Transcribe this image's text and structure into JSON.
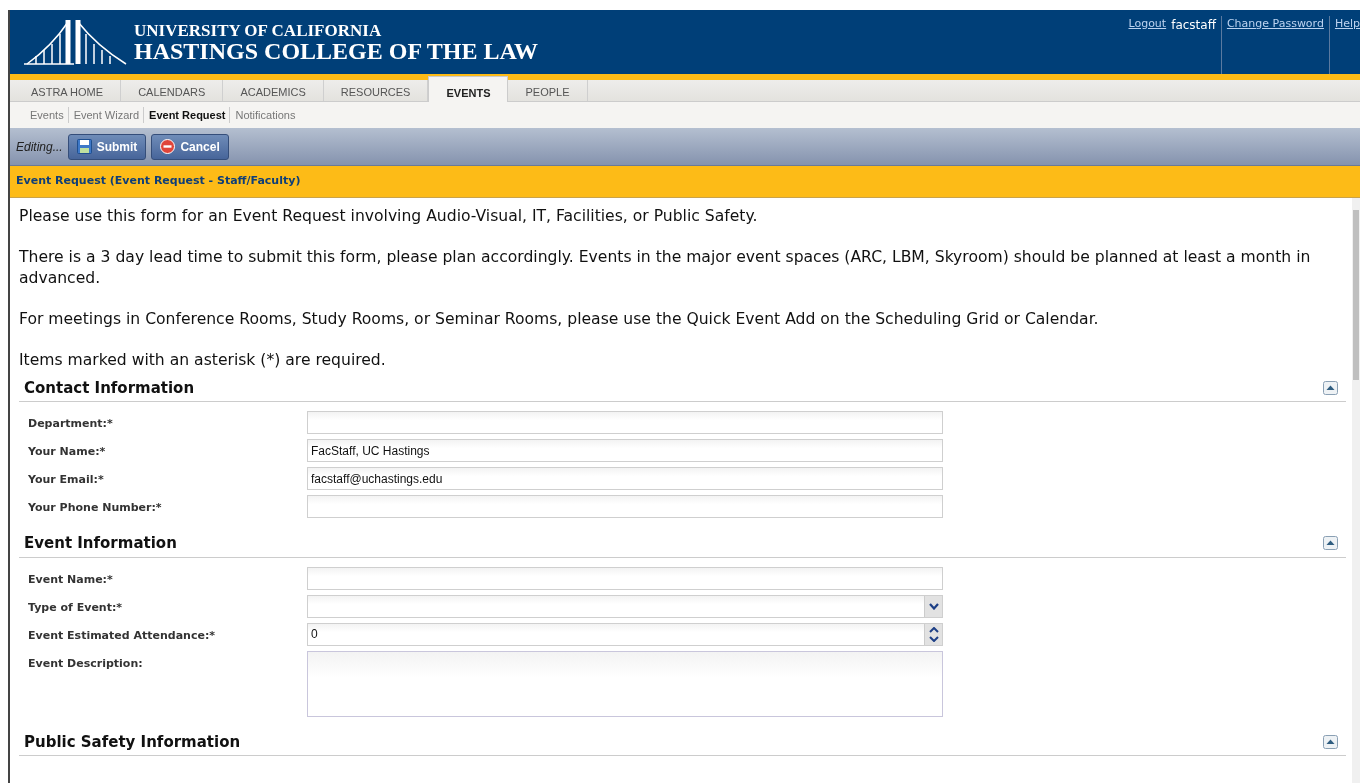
{
  "header": {
    "title_line1": "UNIVERSITY OF CALIFORNIA",
    "title_line2": "HASTINGS COLLEGE OF THE LAW",
    "user_links": [
      {
        "kind": "link",
        "text": "Logout"
      },
      {
        "kind": "user",
        "text": "facstaff"
      },
      {
        "kind": "link",
        "text": "Change Password"
      },
      {
        "kind": "link",
        "text": "Help"
      }
    ]
  },
  "tabs": [
    {
      "label": "ASTRA HOME",
      "selected": false
    },
    {
      "label": "CALENDARS",
      "selected": false
    },
    {
      "label": "ACADEMICS",
      "selected": false
    },
    {
      "label": "RESOURCES",
      "selected": false
    },
    {
      "label": "EVENTS",
      "selected": true
    },
    {
      "label": "PEOPLE",
      "selected": false
    }
  ],
  "subnav": [
    {
      "label": "Events",
      "selected": false
    },
    {
      "label": "Event Wizard",
      "selected": false
    },
    {
      "label": "Event Request",
      "selected": true
    },
    {
      "label": "Notifications",
      "selected": false
    }
  ],
  "toolbar": {
    "status": "Editing...",
    "buttons": [
      {
        "kind": "submit",
        "label": "Submit"
      },
      {
        "kind": "cancel",
        "label": "Cancel"
      }
    ]
  },
  "form_title": "Event Request (Event Request - Staff/Faculty)",
  "intro": [
    "Please use this form for an Event Request involving Audio-Visual, IT, Facilities, or Public Safety.",
    "There is a 3 day lead time to submit this form, please plan accordingly. Events in the major event spaces (ARC, LBM, Skyroom) should be planned at least a month in advanced.",
    "For meetings in Conference Rooms, Study Rooms, or Seminar Rooms, please use the Quick Event Add on the Scheduling Grid or Calendar.",
    "Items marked with an asterisk (*) are required."
  ],
  "sections": [
    {
      "title": "Contact Information",
      "fields": [
        {
          "label": "Department:*",
          "kind": "text"
        },
        {
          "label": "Your Name:*",
          "kind": "text",
          "value": "FacStaff, UC Hastings"
        },
        {
          "label": "Your Email:*",
          "kind": "text",
          "value": "facstaff@uchastings.edu"
        },
        {
          "label": "Your Phone Number:*",
          "kind": "text"
        }
      ]
    },
    {
      "title": "Event Information",
      "fields": [
        {
          "label": "Event Name:*",
          "kind": "text"
        },
        {
          "label": "Type of Event:*",
          "kind": "select"
        },
        {
          "label": "Event Estimated Attendance:*",
          "kind": "number",
          "value": "0"
        },
        {
          "label": "Event Description:",
          "kind": "textarea"
        }
      ]
    },
    {
      "title": "Public Safety Information"
    }
  ]
}
